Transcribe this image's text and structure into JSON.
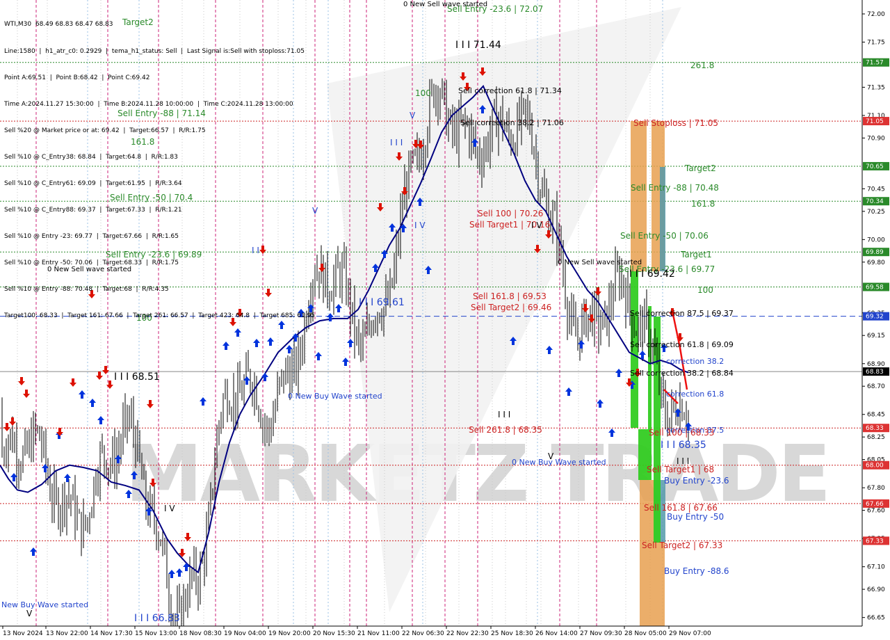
{
  "symbol_header": "WTI,M30  68.49 68.83 68.47 68.83",
  "info_lines": [
    "Line:1580  |  h1_atr_c0: 0.2929  |  tema_h1_status: Sell  |  Last Signal is:Sell with stoploss:71.05",
    "Point A:69.51  |  Point B:68.42  |  Point C:69.42",
    "Time A:2024.11.27 15:30:00  |  Time B:2024.11.28 10:00:00  |  Time C:2024.11.28 13:00:00",
    "Sell %20 @ Market price or at: 69.42  |  Target:66.57  |  R/R:1.75",
    "Sell %10 @ C_Entry38: 68.84  |  Target:64.8  |  R/R:1.83",
    "Sell %10 @ C_Entry61: 69.09  |  Target:61.95  |  R/R:3.64",
    "Sell %10 @ C_Entry88: 69.37  |  Target:67.33  |  R/R:1.21",
    "Sell %10 @ Entry -23: 69.77  |  Target:67.66  |  R/R:1.65",
    "Sell %10 @ Entry -50: 70.06  |  Target:68.33  |  R/R:1.75",
    "Sell %10 @ Entry -88: 70.48  |  Target:68  |  R/R:4.35",
    "Target100: 68.33  |  Target 161: 67.66  |  Target 261: 66.57  |  Target 423: 64.8  |  Target 685: 61.95"
  ],
  "watermark": "MARKETZ TRADE",
  "colors": {
    "up_arrow": "#0033dd",
    "down_arrow": "#dd1100",
    "ma_line": "#000080",
    "stop_box": "#e8a050",
    "green_box": "#33cc22",
    "blue_box": "#5599aa",
    "level_green": "#2a8a2a",
    "level_red": "#cc2222",
    "level_blue": "#2244cc"
  },
  "chart_data": {
    "type": "candlestick",
    "timeframe": "M30",
    "ylim": [
      66.6,
      72.1
    ],
    "y_ticks": [
      "72.00",
      "71.75",
      "71.35",
      "71.10",
      "70.90",
      "70.45",
      "70.25",
      "70.00",
      "69.80",
      "69.35",
      "69.15",
      "68.90",
      "68.70",
      "68.45",
      "68.25",
      "68.05",
      "67.80",
      "67.60",
      "67.35",
      "67.10",
      "66.90",
      "66.65"
    ],
    "x_ticks": [
      "13 Nov 2024",
      "13 Nov 22:00",
      "14 Nov 17:30",
      "15 Nov 13:00",
      "18 Nov 08:30",
      "19 Nov 04:00",
      "19 Nov 20:00",
      "20 Nov 15:30",
      "21 Nov 11:00",
      "22 Nov 06:30",
      "22 Nov 22:30",
      "25 Nov 18:30",
      "26 Nov 14:00",
      "27 Nov 09:30",
      "28 Nov 05:00",
      "29 Nov 07:00"
    ],
    "price_levels": [
      {
        "label": "71.57",
        "value": 71.57,
        "color": "green",
        "style": "dotted"
      },
      {
        "label": "71.05",
        "value": 71.05,
        "color": "red",
        "style": "dotted"
      },
      {
        "label": "70.65",
        "value": 70.65,
        "color": "green",
        "style": "dotted"
      },
      {
        "label": "70.34",
        "value": 70.34,
        "color": "green",
        "style": "dotted"
      },
      {
        "label": "69.89",
        "value": 69.89,
        "color": "green",
        "style": "dotted"
      },
      {
        "label": "69.58",
        "value": 69.58,
        "color": "green",
        "style": "dotted"
      },
      {
        "label": "69.32",
        "value": 69.32,
        "color": "blue",
        "style": "dashed"
      },
      {
        "label": "68.83",
        "value": 68.83,
        "color": "dark",
        "style": "solid"
      },
      {
        "label": "68.33",
        "value": 68.33,
        "color": "red",
        "style": "dotted"
      },
      {
        "label": "68.00",
        "value": 68.0,
        "color": "red",
        "style": "dotted"
      },
      {
        "label": "67.66",
        "value": 67.66,
        "color": "red",
        "style": "dotted"
      },
      {
        "label": "67.33",
        "value": 67.33,
        "color": "red",
        "style": "dotted"
      }
    ],
    "ma_series": [
      {
        "x": 0,
        "y": 68.0
      },
      {
        "x": 12,
        "y": 67.88
      },
      {
        "x": 25,
        "y": 67.78
      },
      {
        "x": 40,
        "y": 67.76
      },
      {
        "x": 60,
        "y": 67.83
      },
      {
        "x": 80,
        "y": 67.95
      },
      {
        "x": 100,
        "y": 68.0
      },
      {
        "x": 120,
        "y": 67.98
      },
      {
        "x": 140,
        "y": 67.95
      },
      {
        "x": 160,
        "y": 67.85
      },
      {
        "x": 180,
        "y": 67.82
      },
      {
        "x": 200,
        "y": 67.78
      },
      {
        "x": 220,
        "y": 67.6
      },
      {
        "x": 240,
        "y": 67.35
      },
      {
        "x": 255,
        "y": 67.22
      },
      {
        "x": 270,
        "y": 67.12
      },
      {
        "x": 285,
        "y": 67.05
      },
      {
        "x": 300,
        "y": 67.4
      },
      {
        "x": 315,
        "y": 67.85
      },
      {
        "x": 330,
        "y": 68.2
      },
      {
        "x": 345,
        "y": 68.45
      },
      {
        "x": 360,
        "y": 68.62
      },
      {
        "x": 380,
        "y": 68.8
      },
      {
        "x": 400,
        "y": 69.0
      },
      {
        "x": 420,
        "y": 69.12
      },
      {
        "x": 440,
        "y": 69.22
      },
      {
        "x": 460,
        "y": 69.28
      },
      {
        "x": 480,
        "y": 69.3
      },
      {
        "x": 500,
        "y": 69.3
      },
      {
        "x": 515,
        "y": 69.38
      },
      {
        "x": 530,
        "y": 69.55
      },
      {
        "x": 545,
        "y": 69.75
      },
      {
        "x": 560,
        "y": 69.95
      },
      {
        "x": 575,
        "y": 70.1
      },
      {
        "x": 590,
        "y": 70.3
      },
      {
        "x": 605,
        "y": 70.5
      },
      {
        "x": 620,
        "y": 70.72
      },
      {
        "x": 635,
        "y": 70.95
      },
      {
        "x": 650,
        "y": 71.1
      },
      {
        "x": 665,
        "y": 71.18
      },
      {
        "x": 680,
        "y": 71.26
      },
      {
        "x": 695,
        "y": 71.36
      },
      {
        "x": 710,
        "y": 71.15
      },
      {
        "x": 725,
        "y": 70.95
      },
      {
        "x": 740,
        "y": 70.75
      },
      {
        "x": 755,
        "y": 70.52
      },
      {
        "x": 770,
        "y": 70.35
      },
      {
        "x": 785,
        "y": 70.25
      },
      {
        "x": 800,
        "y": 70.05
      },
      {
        "x": 815,
        "y": 69.85
      },
      {
        "x": 830,
        "y": 69.7
      },
      {
        "x": 845,
        "y": 69.55
      },
      {
        "x": 860,
        "y": 69.45
      },
      {
        "x": 875,
        "y": 69.3
      },
      {
        "x": 890,
        "y": 69.15
      },
      {
        "x": 905,
        "y": 69.0
      },
      {
        "x": 920,
        "y": 68.95
      },
      {
        "x": 935,
        "y": 68.9
      },
      {
        "x": 950,
        "y": 68.93
      },
      {
        "x": 965,
        "y": 68.9
      },
      {
        "x": 978,
        "y": 68.85
      },
      {
        "x": 990,
        "y": 68.82
      }
    ],
    "vlines_magenta": [
      52,
      155,
      228,
      310,
      378,
      453,
      503,
      527,
      593,
      640,
      687,
      805,
      858
    ],
    "vlines_blue": [
      126,
      200,
      422,
      472,
      608,
      773,
      953
    ],
    "vlines_grey": [
      25,
      68,
      145,
      262,
      293,
      345,
      400,
      440,
      495,
      553,
      612,
      660,
      708,
      727,
      757,
      778,
      832,
      900,
      935
    ],
    "annotations": [
      {
        "text": "Sell Entry -23.6 | 72.07",
        "x": 643,
        "y": 17,
        "color": "green",
        "size": 12
      },
      {
        "text": "0 New Sell wave started",
        "x": 580,
        "y": 9,
        "color": "black",
        "size": 10
      },
      {
        "text": "I I I 71.44",
        "x": 655,
        "y": 69,
        "color": "black",
        "size": 14
      },
      {
        "text": "261.8",
        "x": 993,
        "y": 98,
        "color": "green",
        "size": 12
      },
      {
        "text": "100",
        "x": 597,
        "y": 138,
        "color": "green",
        "size": 12
      },
      {
        "text": "Sell correction 61.8 | 71.34",
        "x": 659,
        "y": 134,
        "color": "black",
        "size": 11
      },
      {
        "text": "Sell Entry -88 | 71.14",
        "x": 169,
        "y": 167,
        "color": "green",
        "size": 12
      },
      {
        "text": "Sell correction 38.2 | 71.06",
        "x": 662,
        "y": 180,
        "color": "black",
        "size": 11
      },
      {
        "text": "Sell Stoploss | 71.05",
        "x": 911,
        "y": 181,
        "color": "red",
        "size": 12
      },
      {
        "text": "161.8",
        "x": 188,
        "y": 208,
        "color": "green",
        "size": 12
      },
      {
        "text": "Target2",
        "x": 176,
        "y": 36,
        "color": "green",
        "size": 12
      },
      {
        "text": "I I I",
        "x": 561,
        "y": 209,
        "color": "blue",
        "size": 12
      },
      {
        "text": "Target2",
        "x": 985,
        "y": 246,
        "color": "green",
        "size": 12
      },
      {
        "text": "Sell Entry -88 | 70.48",
        "x": 907,
        "y": 274,
        "color": "green",
        "size": 12
      },
      {
        "text": "Sell Entry -50 | 70.4",
        "x": 158,
        "y": 288,
        "color": "green",
        "size": 12
      },
      {
        "text": "161.8",
        "x": 994,
        "y": 297,
        "color": "green",
        "size": 12
      },
      {
        "text": "Sell 100 | 70.26",
        "x": 687,
        "y": 311,
        "color": "red",
        "size": 12
      },
      {
        "text": "Sell Target1 | 70.16",
        "x": 675,
        "y": 327,
        "color": "red",
        "size": 12
      },
      {
        "text": "Sell Entry -50 | 70.06",
        "x": 892,
        "y": 343,
        "color": "green",
        "size": 12
      },
      {
        "text": "Sell Entry -23.6 | 69.89",
        "x": 152,
        "y": 370,
        "color": "green",
        "size": 12
      },
      {
        "text": "Target1",
        "x": 979,
        "y": 370,
        "color": "green",
        "size": 12
      },
      {
        "text": "0 New Sell wave started",
        "x": 802,
        "y": 380,
        "color": "black",
        "size": 10
      },
      {
        "text": "0 New Sell wave started",
        "x": 68,
        "y": 390,
        "color": "black",
        "size": 10
      },
      {
        "text": "Sell Entry -23.6 | 69.77",
        "x": 890,
        "y": 391,
        "color": "green",
        "size": 12
      },
      {
        "text": "I I I 69.42",
        "x": 905,
        "y": 398,
        "color": "black",
        "size": 14
      },
      {
        "text": "100",
        "x": 1003,
        "y": 421,
        "color": "green",
        "size": 12
      },
      {
        "text": "Sell 161.8 | 69.53",
        "x": 680,
        "y": 430,
        "color": "red",
        "size": 12
      },
      {
        "text": "I I I 69.61",
        "x": 516,
        "y": 439,
        "color": "blue",
        "size": 14
      },
      {
        "text": "Sell Target2 | 69.46",
        "x": 677,
        "y": 446,
        "color": "red",
        "size": 12
      },
      {
        "text": "Sell correction 87.5 | 69.37",
        "x": 906,
        "y": 454,
        "color": "black",
        "size": 11
      },
      {
        "text": "100",
        "x": 196,
        "y": 461,
        "color": "green",
        "size": 12
      },
      {
        "text": "Sell correction 61.8 | 69.09",
        "x": 906,
        "y": 499,
        "color": "black",
        "size": 11
      },
      {
        "text": "correction 38.2",
        "x": 958,
        "y": 523,
        "color": "blue",
        "size": 11
      },
      {
        "text": "Sell correction 38.2 | 68.84",
        "x": 906,
        "y": 540,
        "color": "black",
        "size": 11
      },
      {
        "text": "I I I 68.51",
        "x": 164,
        "y": 546,
        "color": "black",
        "size": 14
      },
      {
        "text": "correction 61.8",
        "x": 958,
        "y": 570,
        "color": "blue",
        "size": 11
      },
      {
        "text": "0 New Buy Wave started",
        "x": 414,
        "y": 573,
        "color": "blue",
        "size": 11
      },
      {
        "text": "I I I",
        "x": 716,
        "y": 600,
        "color": "black",
        "size": 12
      },
      {
        "text": "Sell 261.8 | 68.35",
        "x": 674,
        "y": 622,
        "color": "red",
        "size": 12
      },
      {
        "text": "correction 87.5",
        "x": 958,
        "y": 622,
        "color": "blue",
        "size": 11
      },
      {
        "text": "Sell 100 | 68.33",
        "x": 933,
        "y": 626,
        "color": "red",
        "size": 12
      },
      {
        "text": "I I I 68.35",
        "x": 950,
        "y": 644,
        "color": "blue",
        "size": 14
      },
      {
        "text": "V",
        "x": 788,
        "y": 660,
        "color": "black",
        "size": 12
      },
      {
        "text": "I I I",
        "x": 973,
        "y": 667,
        "color": "black",
        "size": 12
      },
      {
        "text": "0 New Buy Wave started",
        "x": 736,
        "y": 668,
        "color": "blue",
        "size": 11
      },
      {
        "text": "Sell Target1 | 68",
        "x": 930,
        "y": 679,
        "color": "red",
        "size": 12
      },
      {
        "text": "Buy Entry -23.6",
        "x": 955,
        "y": 695,
        "color": "blue",
        "size": 12
      },
      {
        "text": "Sell 161.8 | 67.66",
        "x": 926,
        "y": 734,
        "color": "red",
        "size": 12
      },
      {
        "text": "I V",
        "x": 236,
        "y": 735,
        "color": "black",
        "size": 12
      },
      {
        "text": "Buy Entry -50",
        "x": 959,
        "y": 747,
        "color": "blue",
        "size": 12
      },
      {
        "text": "Sell Target2 | 67.33",
        "x": 923,
        "y": 788,
        "color": "red",
        "size": 12
      },
      {
        "text": "Buy Entry -88.6",
        "x": 955,
        "y": 825,
        "color": "blue",
        "size": 12
      },
      {
        "text": "New Buy Wave started",
        "x": 2,
        "y": 873,
        "color": "blue",
        "size": 11
      },
      {
        "text": "V",
        "x": 38,
        "y": 886,
        "color": "black",
        "size": 12
      },
      {
        "text": "I I I 66.83",
        "x": 193,
        "y": 893,
        "color": "blue",
        "size": 14
      },
      {
        "text": "V",
        "x": 589,
        "y": 170,
        "color": "blue",
        "size": 12
      },
      {
        "text": "V",
        "x": 449,
        "y": 307,
        "color": "blue",
        "size": 12
      },
      {
        "text": "I V",
        "x": 764,
        "y": 328,
        "color": "black",
        "size": 12
      },
      {
        "text": "I V",
        "x": 596,
        "y": 328,
        "color": "blue",
        "size": 12
      },
      {
        "text": "I I",
        "x": 362,
        "y": 364,
        "color": "blue",
        "size": 12
      }
    ],
    "up_arrows": [
      [
        20,
        686
      ],
      [
        48,
        793
      ],
      [
        65,
        673
      ],
      [
        85,
        625
      ],
      [
        97,
        687
      ],
      [
        118,
        567
      ],
      [
        133,
        579
      ],
      [
        145,
        604
      ],
      [
        170,
        660
      ],
      [
        185,
        710
      ],
      [
        193,
        683
      ],
      [
        214,
        735
      ],
      [
        247,
        825
      ],
      [
        258,
        823
      ],
      [
        268,
        815
      ],
      [
        292,
        577
      ],
      [
        325,
        497
      ],
      [
        342,
        478
      ],
      [
        355,
        547
      ],
      [
        369,
        493
      ],
      [
        381,
        542
      ],
      [
        389,
        491
      ],
      [
        405,
        467
      ],
      [
        416,
        502
      ],
      [
        425,
        485
      ],
      [
        433,
        450
      ],
      [
        447,
        443
      ],
      [
        458,
        512
      ],
      [
        475,
        456
      ],
      [
        487,
        443
      ],
      [
        497,
        520
      ],
      [
        504,
        493
      ],
      [
        540,
        385
      ],
      [
        553,
        365
      ],
      [
        564,
        327
      ],
      [
        580,
        328
      ],
      [
        604,
        290
      ],
      [
        616,
        388
      ],
      [
        683,
        205
      ],
      [
        694,
        157
      ],
      [
        738,
        490
      ],
      [
        790,
        503
      ],
      [
        818,
        563
      ],
      [
        836,
        495
      ],
      [
        863,
        580
      ],
      [
        880,
        622
      ],
      [
        890,
        536
      ],
      [
        909,
        553
      ],
      [
        924,
        510
      ],
      [
        955,
        500
      ],
      [
        975,
        593
      ],
      [
        990,
        613
      ]
    ],
    "down_arrows": [
      [
        10,
        614
      ],
      [
        18,
        606
      ],
      [
        31,
        548
      ],
      [
        38,
        566
      ],
      [
        86,
        621
      ],
      [
        105,
        550
      ],
      [
        132,
        423
      ],
      [
        143,
        540
      ],
      [
        152,
        532
      ],
      [
        158,
        553
      ],
      [
        216,
        581
      ],
      [
        220,
        694
      ],
      [
        262,
        795
      ],
      [
        270,
        772
      ],
      [
        335,
        463
      ],
      [
        345,
        450
      ],
      [
        378,
        359
      ],
      [
        386,
        421
      ],
      [
        463,
        385
      ],
      [
        547,
        298
      ],
      [
        574,
        225
      ],
      [
        582,
        275
      ],
      [
        598,
        207
      ],
      [
        605,
        208
      ],
      [
        666,
        110
      ],
      [
        672,
        125
      ],
      [
        694,
        103
      ],
      [
        773,
        358
      ],
      [
        789,
        337
      ],
      [
        842,
        443
      ],
      [
        851,
        458
      ],
      [
        860,
        419
      ],
      [
        905,
        550
      ],
      [
        917,
        536
      ],
      [
        967,
        449
      ],
      [
        978,
        485
      ]
    ],
    "green_boxes": [
      [
        907,
        390,
        918,
        615
      ],
      [
        918,
        617,
        932,
        690
      ],
      [
        932,
        440,
        937,
        690
      ],
      [
        940,
        455,
        950,
        780
      ]
    ],
    "stop_boxes": [
      [
        907,
        174,
        930,
        390
      ],
      [
        937,
        174,
        956,
        390
      ],
      [
        920,
        690,
        941,
        900
      ],
      [
        941,
        780,
        956,
        900
      ]
    ],
    "blue_boxes": [
      [
        949,
        240,
        957,
        390
      ],
      [
        941,
        690,
        949,
        780
      ],
      [
        949,
        690,
        957,
        780
      ]
    ]
  }
}
